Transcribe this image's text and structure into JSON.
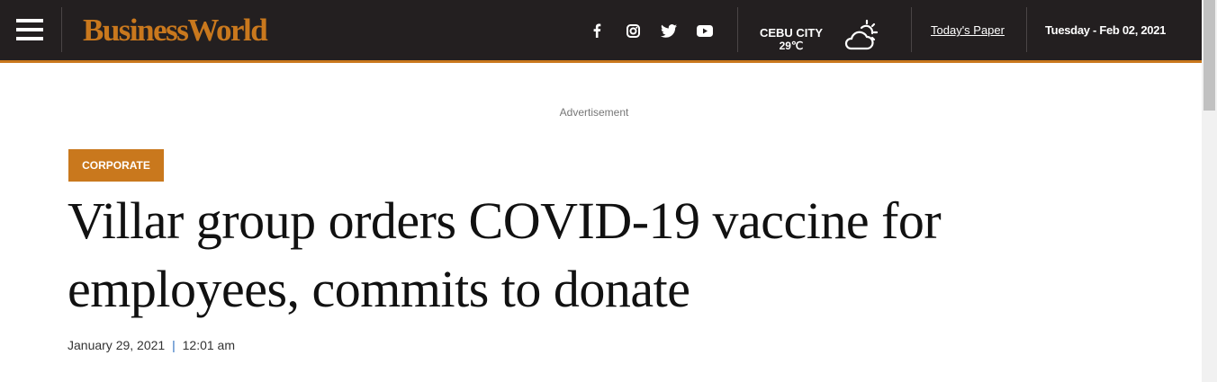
{
  "header": {
    "logo": "BusinessWorld",
    "social": [
      {
        "icon": "facebook-icon"
      },
      {
        "icon": "instagram-icon"
      },
      {
        "icon": "twitter-icon"
      },
      {
        "icon": "youtube-icon"
      }
    ],
    "weather": {
      "city": "CEBU CITY",
      "temperature": "29℃",
      "icon": "partly-cloudy-icon"
    },
    "todays_paper": "Today's Paper",
    "date": "Tuesday - Feb 02, 2021"
  },
  "advertisement_label": "Advertisement",
  "article": {
    "category": "CORPORATE",
    "title": "Villar group orders COVID-19 vaccine for employees, commits to donate",
    "date": "January 29, 2021",
    "separator": "|",
    "time": "12:01 am"
  },
  "colors": {
    "accent": "#c9781d",
    "header_bg": "#231f20"
  }
}
